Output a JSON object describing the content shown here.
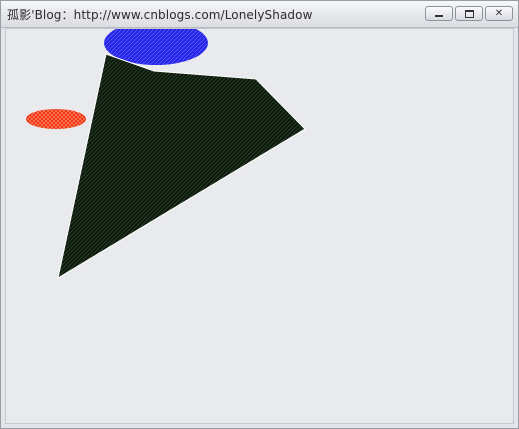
{
  "window": {
    "title": "孤影'Blog：http://www.cnblogs.com/LonelyShadow",
    "minimize_label": "",
    "maximize_label": "",
    "close_label": "✕"
  },
  "canvas": {
    "background": "#e9eaee",
    "shapes": [
      {
        "kind": "ellipse",
        "name": "blue-ellipse",
        "fill": "#2323e6",
        "hatch": "#5050ff"
      },
      {
        "kind": "ellipse",
        "name": "red-ellipse",
        "fill": "#ee2a10",
        "hatch": "#ff7a55"
      },
      {
        "kind": "polygon",
        "name": "dark-polygon",
        "fill": "#0d160d",
        "hatch": "#2c4a2c",
        "outline": "#ffffff"
      }
    ]
  }
}
